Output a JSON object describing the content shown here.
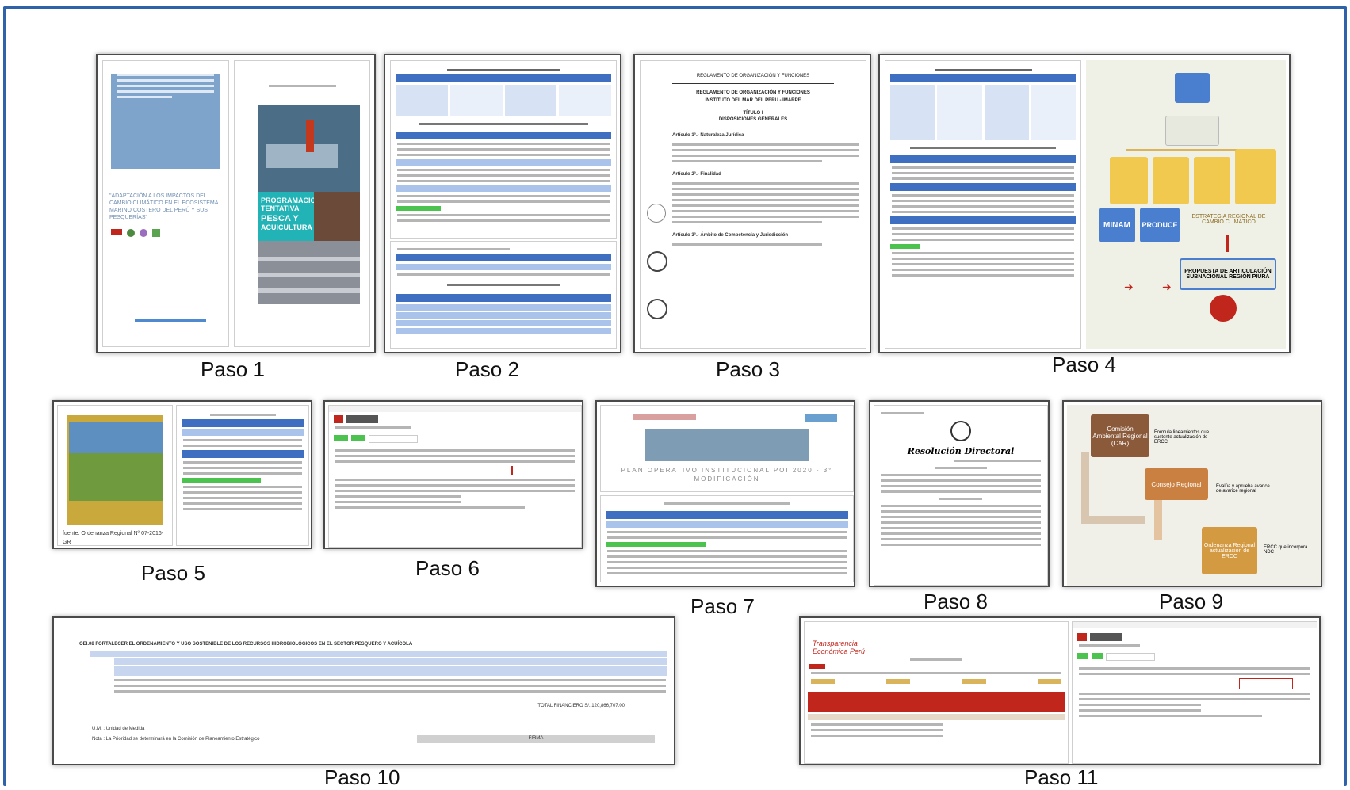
{
  "steps": [
    {
      "label": "Paso 1"
    },
    {
      "label": "Paso 2"
    },
    {
      "label": "Paso 3"
    },
    {
      "label": "Paso 4"
    },
    {
      "label": "Paso 5"
    },
    {
      "label": "Paso 6"
    },
    {
      "label": "Paso 7"
    },
    {
      "label": "Paso 8"
    },
    {
      "label": "Paso 9"
    },
    {
      "label": "Paso 10"
    },
    {
      "label": "Paso 11"
    }
  ],
  "paso1": {
    "quote": "\"ADAPTACIÓN A LOS IMPACTOS DEL CAMBIO CLIMÁTICO EN EL ECOSISTEMA MARINO COSTERO DEL PERÚ Y SUS PESQUERÍAS\"",
    "cover_title_line1": "PROGRAMACION",
    "cover_title_line2": "TENTATIVA",
    "cover_title_line3": "PESCA Y",
    "cover_title_line4": "ACUICULTURA"
  },
  "paso3": {
    "title": "REGLAMENTO DE ORGANIZACIÓN Y FUNCIONES",
    "subtitle": "INSTITUTO DEL MAR DEL PERÚ - IMARPE",
    "titulo": "TÍTULO I",
    "disposiciones": "DISPOSICIONES GENERALES",
    "art1": "Artículo 1°.- Naturaleza Jurídica",
    "art2": "Artículo 2°.- Finalidad",
    "art3": "Artículo 3°.- Ámbito de Competencia y Jurisdicción"
  },
  "paso4": {
    "minam": "MINAM",
    "produce": "PRODUCE",
    "estrategia": "ESTRATEGIA REGIONAL DE CAMBIO CLIMÁTICO",
    "propuesta": "PROPUESTA DE ARTICULACIÓN SUBNACIONAL REGIÓN PIURA"
  },
  "paso5": {
    "fuente": "fuente: Ordenanza Regional Nº 07-2016-GR"
  },
  "paso7": {
    "banner": "PLAN OPERATIVO INSTITUCIONAL POI 2020 - 3° MODIFICACIÓN"
  },
  "paso8": {
    "heading": "Resolución Directoral"
  },
  "paso9": {
    "car": "Comisión Ambiental Regional (CAR)",
    "car_note": "Formula lineamientos que sustente actualización de ERCC",
    "consejo": "Consejo Regional",
    "consejo_note": "Evalúa y aprueba avance de avance regional",
    "ordenanza": "Ordenanza Regional actualización de ERCC",
    "ordenanza_note": "ERCC que incorpora NDC"
  },
  "paso10": {
    "header": "OEI.08 FORTALECER EL ORDENAMIENTO Y USO SOSTENIBLE DE LOS RECURSOS HIDROBIOLÓGICOS EN EL SECTOR PESQUERO Y ACUÍCOLA",
    "total": "TOTAL FINANCIERO S/. 120,866,707.00",
    "um": "U.M. : Unidad de Medida",
    "nota": "Nota : La Prioridad se determinará en la Comisión de Planeamiento Estratégico",
    "firma": "FIRMA"
  },
  "paso11": {
    "portal": "Transparencia Económica Perú"
  },
  "colors": {
    "frame": "#2f62a8",
    "blue": "#3e6fc0",
    "green": "#4cc34e",
    "brown": "#8a5a3b",
    "orange": "#c98040",
    "red": "#c0261c"
  }
}
